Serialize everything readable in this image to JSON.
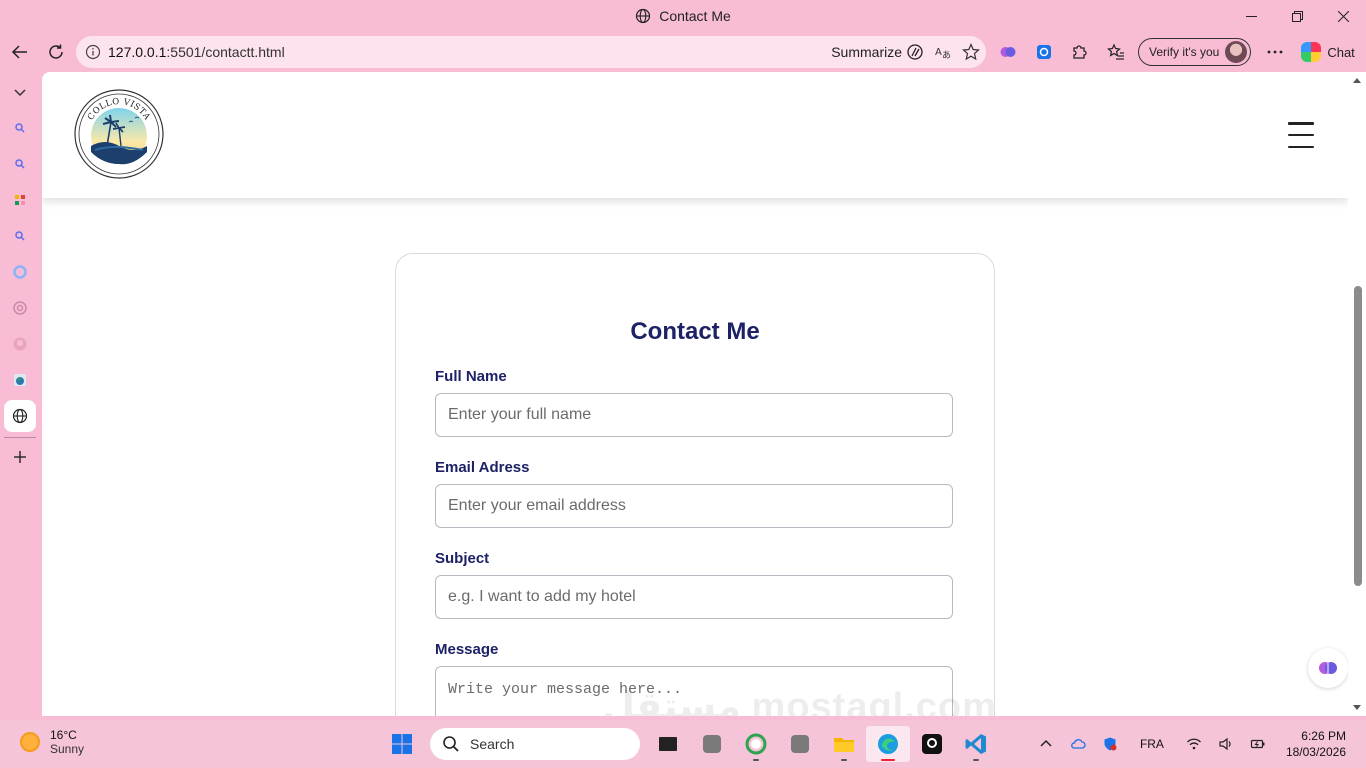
{
  "browser": {
    "tab_title": "Contact Me",
    "url_host": "127.0.0.1",
    "url_rest": ":5501/contactt.html",
    "summarize_label": "Summarize",
    "verify_label": "Verify it's you",
    "chat_label": "Chat"
  },
  "page": {
    "logo_text": "COLLO VISTA",
    "form_title": "Contact Me",
    "fields": [
      {
        "label": "Full Name",
        "placeholder": "Enter your full name"
      },
      {
        "label": "Email Adress",
        "placeholder": "Enter your email address"
      },
      {
        "label": "Subject",
        "placeholder": "e.g. I want to add my hotel"
      },
      {
        "label": "Message",
        "placeholder": "Write your message here..."
      }
    ]
  },
  "watermark": "مستقل mostaql.com",
  "taskbar": {
    "temperature": "16°C",
    "weather": "Sunny",
    "search_label": "Search",
    "language": "FRA",
    "time": "6:26 PM",
    "date": "18/03/2026"
  },
  "colors": {
    "accent": "#1d2266",
    "chrome": "#f8bcd4"
  }
}
